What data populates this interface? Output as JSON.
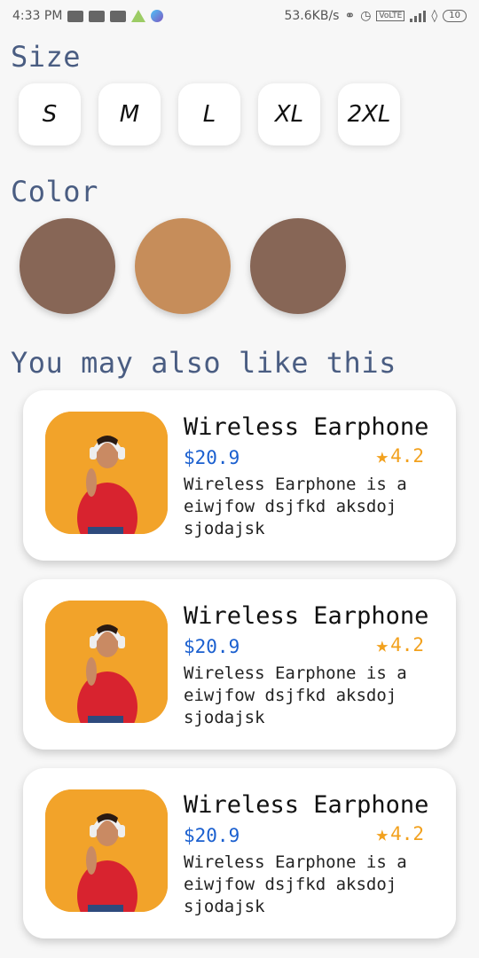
{
  "status_bar": {
    "time": "4:33 PM",
    "network_speed": "53.6KB/s",
    "battery": "10",
    "icons": [
      "message-icon",
      "youtube-icon",
      "youtube-icon",
      "vpn-icon",
      "app-icon",
      "headphones-icon",
      "alarm-icon",
      "volte-icon",
      "signal-icon",
      "wifi-icon",
      "battery-icon"
    ]
  },
  "size_section": {
    "title": "Size",
    "options": [
      "S",
      "M",
      "L",
      "XL",
      "2XL"
    ]
  },
  "color_section": {
    "title": "Color",
    "swatches": [
      "#876656",
      "#c68d5a",
      "#876656"
    ]
  },
  "recommendations": {
    "title": "You may also like this",
    "products": [
      {
        "title": "Wireless Earphone",
        "price": "$20.9",
        "rating": "4.2",
        "description": "Wireless Earphone is a eiwjfow dsjfkd aksdoj sjodajsk"
      },
      {
        "title": "Wireless Earphone",
        "price": "$20.9",
        "rating": "4.2",
        "description": "Wireless Earphone is a eiwjfow dsjfkd aksdoj sjodajsk"
      },
      {
        "title": "Wireless Earphone",
        "price": "$20.9",
        "rating": "4.2",
        "description": "Wireless Earphone is a eiwjfow dsjfkd aksdoj sjodajsk"
      }
    ]
  },
  "colors": {
    "accent_title": "#4a5d82",
    "price": "#1a5fcf",
    "star": "#f2a11e"
  }
}
